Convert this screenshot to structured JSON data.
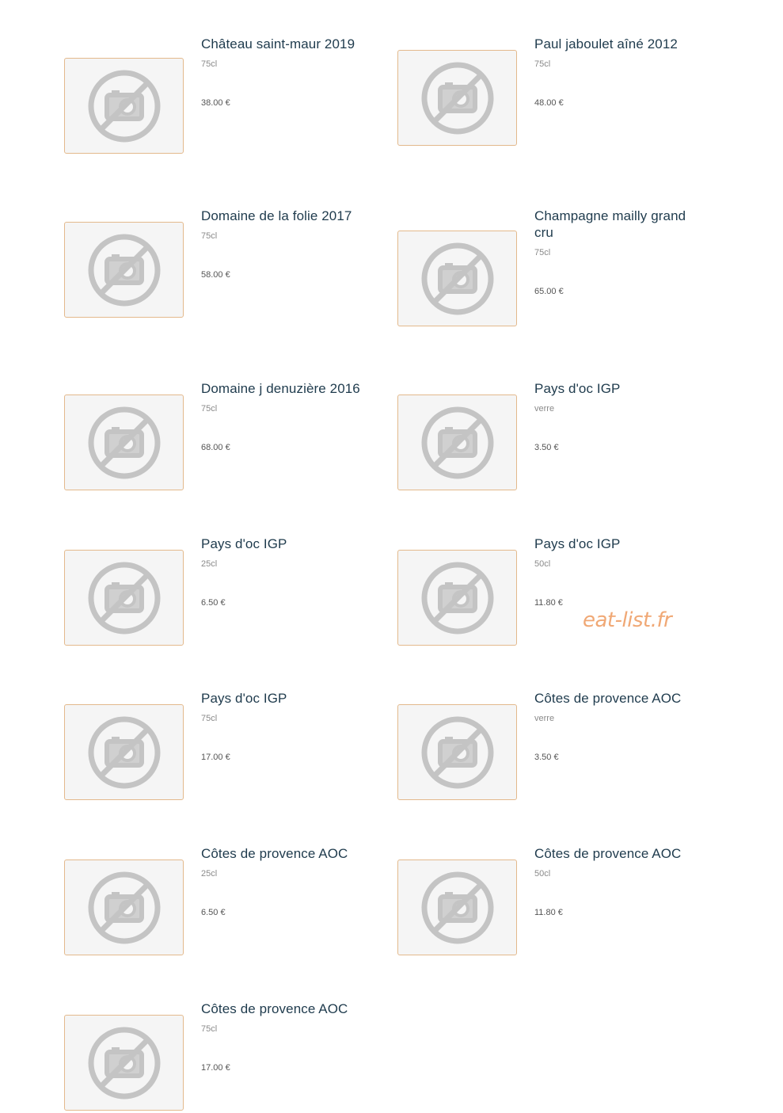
{
  "items": [
    {
      "name": "Château saint-maur 2019",
      "size": "75cl",
      "price": "38.00 €",
      "image_icon": "no-photo-icon"
    },
    {
      "name": "Paul jaboulet aîné 2012",
      "size": "75cl",
      "price": "48.00 €",
      "image_icon": "no-photo-icon"
    },
    {
      "name": "Domaine de la folie 2017",
      "size": "75cl",
      "price": "58.00 €",
      "image_icon": "no-photo-icon"
    },
    {
      "name": "Champagne mailly grand cru",
      "size": "75cl",
      "price": "65.00 €",
      "image_icon": "no-photo-icon"
    },
    {
      "name": "Domaine j denuzière 2016",
      "size": "75cl",
      "price": "68.00 €",
      "image_icon": "no-photo-icon"
    },
    {
      "name": "Pays d'oc IGP",
      "size": "verre",
      "price": "3.50 €",
      "image_icon": "no-photo-icon"
    },
    {
      "name": "Pays d'oc IGP",
      "size": "25cl",
      "price": "6.50 €",
      "image_icon": "no-photo-icon"
    },
    {
      "name": "Pays d'oc IGP",
      "size": "50cl",
      "price": "11.80 €",
      "image_icon": "no-photo-icon"
    },
    {
      "name": "Pays d'oc IGP",
      "size": "75cl",
      "price": "17.00 €",
      "image_icon": "no-photo-icon"
    },
    {
      "name": "Côtes de provence AOC",
      "size": "verre",
      "price": "3.50 €",
      "image_icon": "no-photo-icon"
    },
    {
      "name": "Côtes de provence AOC",
      "size": "25cl",
      "price": "6.50 €",
      "image_icon": "no-photo-icon"
    },
    {
      "name": "Côtes de provence AOC",
      "size": "50cl",
      "price": "11.80 €",
      "image_icon": "no-photo-icon"
    },
    {
      "name": "Côtes de provence AOC",
      "size": "75cl",
      "price": "17.00 €",
      "image_icon": "no-photo-icon"
    }
  ],
  "watermark": "eat-list.fr",
  "colors": {
    "title": "#1f3b4d",
    "image_border": "#e3b98c",
    "watermark": "#f0a875"
  }
}
